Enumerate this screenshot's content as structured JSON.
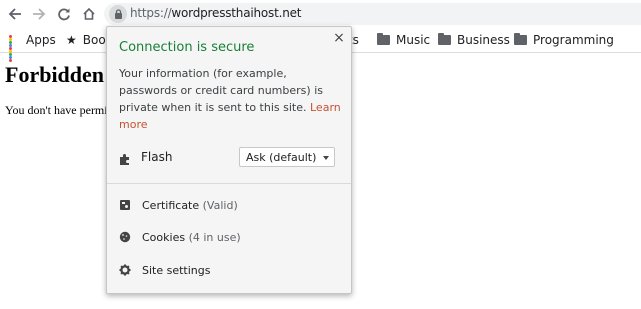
{
  "toolbar": {
    "url_scheme": "https://",
    "url_host": "wordpressthaihost.net"
  },
  "bookmarks": [
    {
      "label": "Apps",
      "icon": "apps-grid-icon"
    },
    {
      "label": "Boo",
      "icon": "star-icon"
    },
    {
      "label": "rts",
      "icon": "folder-icon"
    },
    {
      "label": "Music",
      "icon": "folder-icon"
    },
    {
      "label": "Business",
      "icon": "folder-icon"
    },
    {
      "label": "Programming",
      "icon": "folder-icon"
    }
  ],
  "page": {
    "heading": "Forbidden",
    "text": "You don't have permission"
  },
  "popup": {
    "title": "Connection is secure",
    "description": "Your information (for example, passwords or credit card numbers) is private when it is sent to this site.",
    "learn_more": "Learn more",
    "permission": {
      "label": "Flash",
      "value": "Ask (default)"
    },
    "certificate": {
      "label": "Certificate",
      "status": "(Valid)"
    },
    "cookies": {
      "label": "Cookies",
      "status": "(4 in use)"
    },
    "site_settings": {
      "label": "Site settings"
    },
    "close_symbol": "×"
  },
  "colors": {
    "secure_green": "#188038",
    "learn_more": "#c5522f"
  }
}
